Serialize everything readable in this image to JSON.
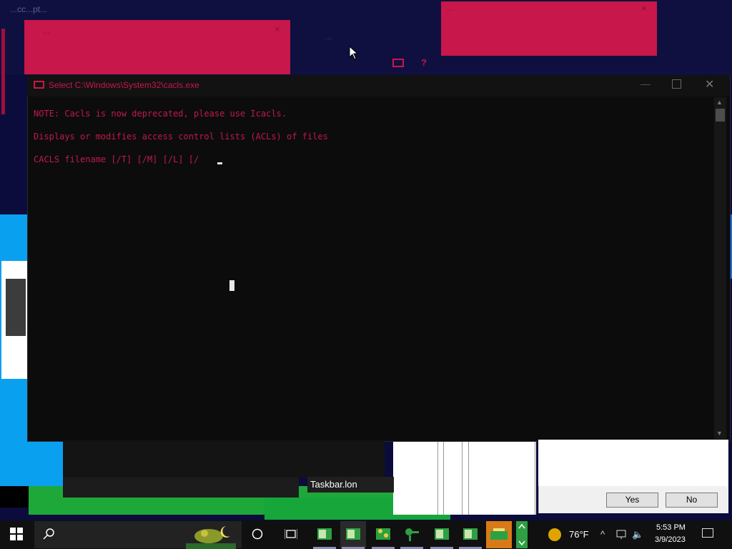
{
  "background": {
    "left_title": "...cc...pt...",
    "mid_title": "...",
    "pink_window_1_title": "...",
    "pink_window_2_title": "...",
    "close_glyph": "×",
    "help_glyph": "?"
  },
  "console": {
    "title": "Select C:\\Windows\\System32\\cacls.exe",
    "lines": [
      "NOTE: Cacls is now deprecated, please use Icacls.",
      "Displays or modifies access control lists (ACLs) of files",
      "CACLS filename [/T] [/M] [/L] [/"
    ],
    "min_glyph": "—",
    "close_glyph": "✕",
    "scroll_up_glyph": "▲",
    "scroll_down_glyph": "▼"
  },
  "tooltip": {
    "text": "Taskbar.lon"
  },
  "dialog": {
    "yes_label": "Yes",
    "no_label": "No"
  },
  "taskbar": {
    "weather_temp": "76°F",
    "time": "5:53 PM",
    "date": "3/9/2023",
    "tray_up_glyph": "^",
    "volume_glyph": "🔈"
  },
  "colors": {
    "console_text": "#c01a4a",
    "pink_window": "#c8174a",
    "taskbar": "#101010"
  }
}
